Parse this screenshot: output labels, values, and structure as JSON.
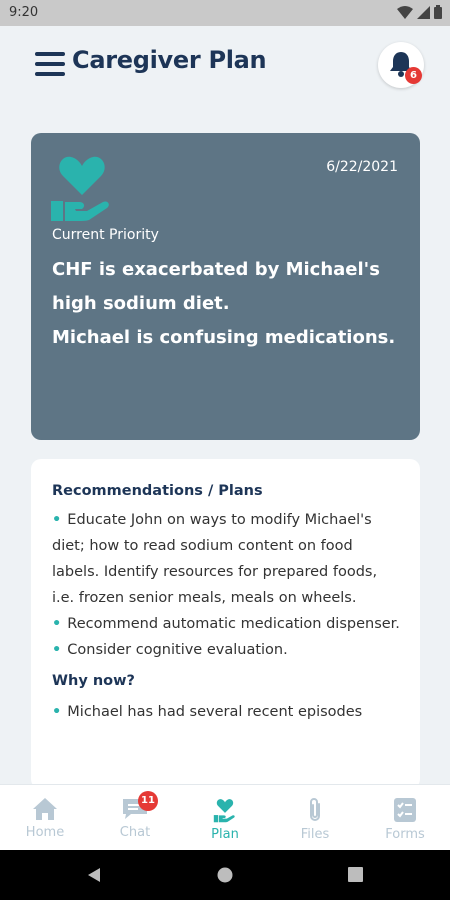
{
  "status_bar": {
    "time": "9:20"
  },
  "header": {
    "title": "Caregiver Plan",
    "notification_count": "6"
  },
  "priority": {
    "date": "6/22/2021",
    "label": "Current Priority",
    "lines": [
      "CHF is exacerbated by Michael's high sodium diet.",
      "Michael is confusing medications."
    ]
  },
  "recommendations": {
    "heading": "Recommendations / Plans",
    "items": [
      "Educate John on ways to modify Michael's diet; how to read sodium content on food labels.  Identify resources for prepared foods, i.e. frozen senior meals, meals on wheels.",
      "Recommend automatic medication dispenser.",
      "Consider cognitive evaluation."
    ],
    "why_heading": "Why now?",
    "why_items": [
      "Michael has had several recent episodes"
    ]
  },
  "bottom_nav": {
    "items": [
      {
        "label": "Home",
        "icon": "home-icon"
      },
      {
        "label": "Chat",
        "icon": "chat-icon",
        "badge": "11"
      },
      {
        "label": "Plan",
        "icon": "heart-hand-icon",
        "active": true
      },
      {
        "label": "Files",
        "icon": "paperclip-icon"
      },
      {
        "label": "Forms",
        "icon": "checklist-icon"
      }
    ]
  },
  "colors": {
    "primary": "#1d3557",
    "accent": "#2ab3ad",
    "card": "#5e7585",
    "badge": "#e53935",
    "inactive": "#b8c8d4"
  }
}
